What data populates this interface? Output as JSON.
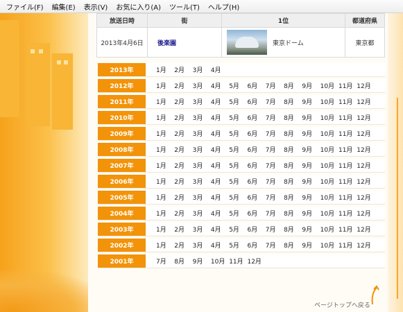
{
  "menu": [
    "ファイル(F)",
    "編集(E)",
    "表示(V)",
    "お気に入り(A)",
    "ツール(T)",
    "ヘルプ(H)"
  ],
  "ranking_table": {
    "headers": [
      "放送日時",
      "街",
      "1位",
      "都道府県"
    ],
    "row": {
      "date": "2013年4月6日",
      "town": "後楽園",
      "place": "東京ドーム",
      "prefecture": "東京都"
    }
  },
  "years": [
    {
      "label": "2013年",
      "months": [
        "1月",
        "2月",
        "3月",
        "4月"
      ]
    },
    {
      "label": "2012年",
      "months": [
        "1月",
        "2月",
        "3月",
        "4月",
        "5月",
        "6月",
        "7月",
        "8月",
        "9月",
        "10月",
        "11月",
        "12月"
      ]
    },
    {
      "label": "2011年",
      "months": [
        "1月",
        "2月",
        "3月",
        "4月",
        "5月",
        "6月",
        "7月",
        "8月",
        "9月",
        "10月",
        "11月",
        "12月"
      ]
    },
    {
      "label": "2010年",
      "months": [
        "1月",
        "2月",
        "3月",
        "4月",
        "5月",
        "6月",
        "7月",
        "8月",
        "9月",
        "10月",
        "11月",
        "12月"
      ]
    },
    {
      "label": "2009年",
      "months": [
        "1月",
        "2月",
        "3月",
        "4月",
        "5月",
        "6月",
        "7月",
        "8月",
        "9月",
        "10月",
        "11月",
        "12月"
      ]
    },
    {
      "label": "2008年",
      "months": [
        "1月",
        "2月",
        "3月",
        "4月",
        "5月",
        "6月",
        "7月",
        "8月",
        "9月",
        "10月",
        "11月",
        "12月"
      ]
    },
    {
      "label": "2007年",
      "months": [
        "1月",
        "2月",
        "3月",
        "4月",
        "5月",
        "6月",
        "7月",
        "8月",
        "9月",
        "10月",
        "11月",
        "12月"
      ]
    },
    {
      "label": "2006年",
      "months": [
        "1月",
        "2月",
        "3月",
        "4月",
        "5月",
        "6月",
        "7月",
        "8月",
        "9月",
        "10月",
        "11月",
        "12月"
      ]
    },
    {
      "label": "2005年",
      "months": [
        "1月",
        "2月",
        "3月",
        "4月",
        "5月",
        "6月",
        "7月",
        "8月",
        "9月",
        "10月",
        "11月",
        "12月"
      ]
    },
    {
      "label": "2004年",
      "months": [
        "1月",
        "2月",
        "3月",
        "4月",
        "5月",
        "6月",
        "7月",
        "8月",
        "9月",
        "10月",
        "11月",
        "12月"
      ]
    },
    {
      "label": "2003年",
      "months": [
        "1月",
        "2月",
        "3月",
        "4月",
        "5月",
        "6月",
        "7月",
        "8月",
        "9月",
        "10月",
        "11月",
        "12月"
      ]
    },
    {
      "label": "2002年",
      "months": [
        "1月",
        "2月",
        "3月",
        "4月",
        "5月",
        "6月",
        "7月",
        "8月",
        "9月",
        "10月",
        "11月",
        "12月"
      ]
    },
    {
      "label": "2001年",
      "months": [
        "7月",
        "8月",
        "9月",
        "10月",
        "11月",
        "12月"
      ]
    }
  ],
  "footer": {
    "page_top_label": "ページトップへ戻る"
  },
  "colors": {
    "accent": "#f29309",
    "link": "#1a1a8c"
  }
}
